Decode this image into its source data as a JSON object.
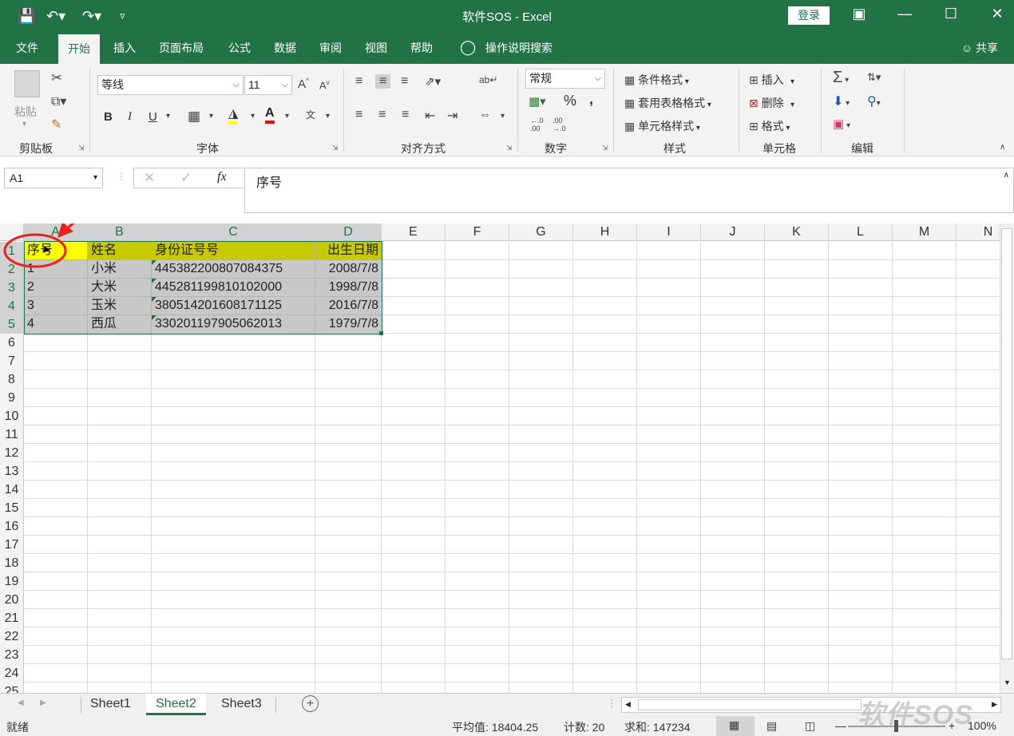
{
  "window": {
    "title": "软件SOS  -  Excel",
    "login_label": "登录"
  },
  "tabs": [
    {
      "label": "文件"
    },
    {
      "label": "开始",
      "active": true
    },
    {
      "label": "插入"
    },
    {
      "label": "页面布局"
    },
    {
      "label": "公式"
    },
    {
      "label": "数据"
    },
    {
      "label": "审阅"
    },
    {
      "label": "视图"
    },
    {
      "label": "帮助"
    },
    {
      "label": "操作说明搜索"
    }
  ],
  "share_label": "共享",
  "ribbon": {
    "clipboard": {
      "paste_label": "粘贴",
      "group_label": "剪贴板"
    },
    "font": {
      "font_name": "等线",
      "font_size": "11",
      "bold": "B",
      "italic": "I",
      "underline": "U",
      "group_label": "字体"
    },
    "alignment": {
      "group_label": "对齐方式"
    },
    "number": {
      "format": "常规",
      "percent": "%",
      "comma": ",",
      "group_label": "数字"
    },
    "styles": {
      "conditional": "条件格式",
      "table": "套用表格格式",
      "cell": "单元格样式",
      "group_label": "样式"
    },
    "cells": {
      "insert": "插入",
      "delete": "删除",
      "format": "格式",
      "group_label": "单元格"
    },
    "editing": {
      "group_label": "编辑"
    }
  },
  "formula_bar": {
    "name_box": "A1",
    "fx": "fx",
    "content": "序号"
  },
  "columns": [
    "A",
    "B",
    "C",
    "D",
    "E",
    "F",
    "G",
    "H",
    "I",
    "J",
    "K",
    "L",
    "M",
    "N"
  ],
  "rows": [
    "1",
    "2",
    "3",
    "4",
    "5",
    "6",
    "7",
    "8",
    "9",
    "10",
    "11",
    "12",
    "13",
    "14",
    "15",
    "16",
    "17",
    "18",
    "19",
    "20",
    "21",
    "22",
    "23",
    "24",
    "25"
  ],
  "table": {
    "header": [
      "序号",
      "姓名",
      "身份证号号",
      "出生日期"
    ],
    "data": [
      [
        "1",
        "小米",
        "445382200807084375",
        "2008/7/8"
      ],
      [
        "2",
        "大米",
        "445281199810102000",
        "1998/7/8"
      ],
      [
        "3",
        "玉米",
        "380514201608171125",
        "2016/7/8"
      ],
      [
        "4",
        "西瓜",
        "330201197905062013",
        "1979/7/8"
      ]
    ]
  },
  "sheets": [
    {
      "label": "Sheet1"
    },
    {
      "label": "Sheet2",
      "active": true
    },
    {
      "label": "Sheet3"
    }
  ],
  "status": {
    "ready": "就绪",
    "average": "平均值: 18404.25",
    "count": "计数: 20",
    "sum": "求和: 147234",
    "zoom": "100%"
  },
  "watermark": "软件SOS",
  "colors": {
    "brand": "#217346",
    "header_fill": "#c9c900",
    "a1_fill": "#ffff00",
    "selection": "#c8c8c8",
    "annotation": "#e8231f"
  }
}
